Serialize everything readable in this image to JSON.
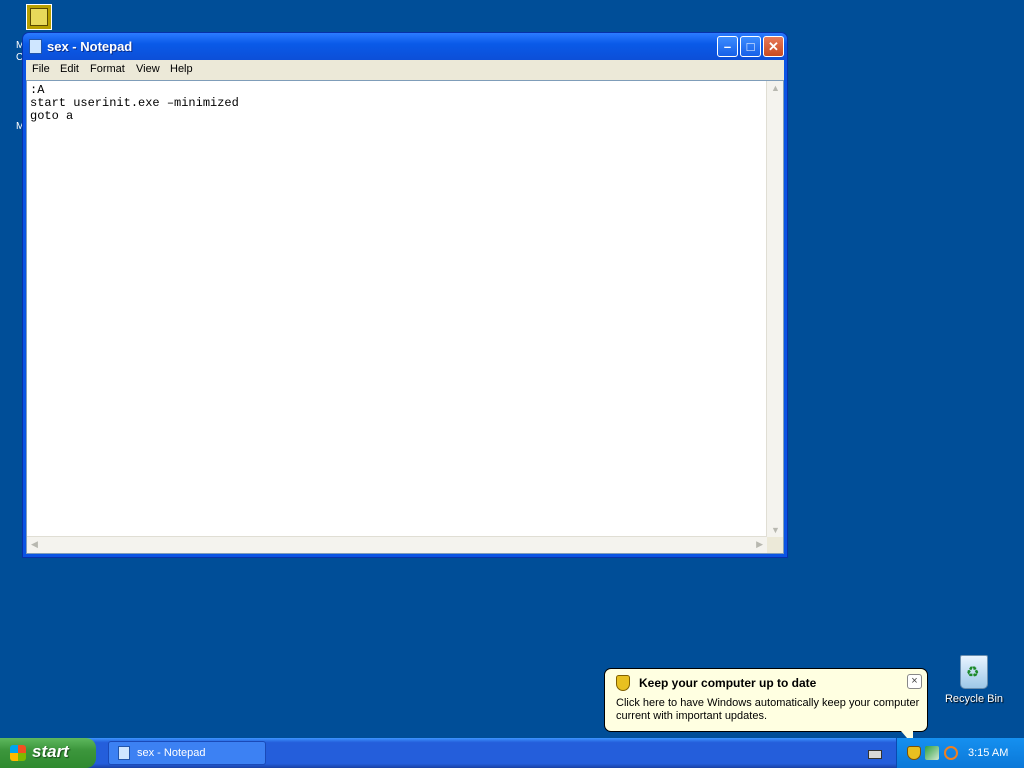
{
  "desktop": {
    "edge_labels": [
      "M",
      "C",
      "M"
    ],
    "recycle_bin_label": "Recycle Bin"
  },
  "notepad": {
    "title": "sex - Notepad",
    "menu": [
      "File",
      "Edit",
      "Format",
      "View",
      "Help"
    ],
    "content": ":A\nstart userinit.exe –minimized\ngoto a",
    "buttons": {
      "minimize": "–",
      "maximize": "□",
      "close": "✕"
    }
  },
  "balloon": {
    "title": "Keep your computer up to date",
    "body": "Click here to have Windows automatically keep your computer current with important updates.",
    "close": "×"
  },
  "taskbar": {
    "start_label": "start",
    "task_label": "sex - Notepad",
    "clock": "3:15 AM"
  }
}
